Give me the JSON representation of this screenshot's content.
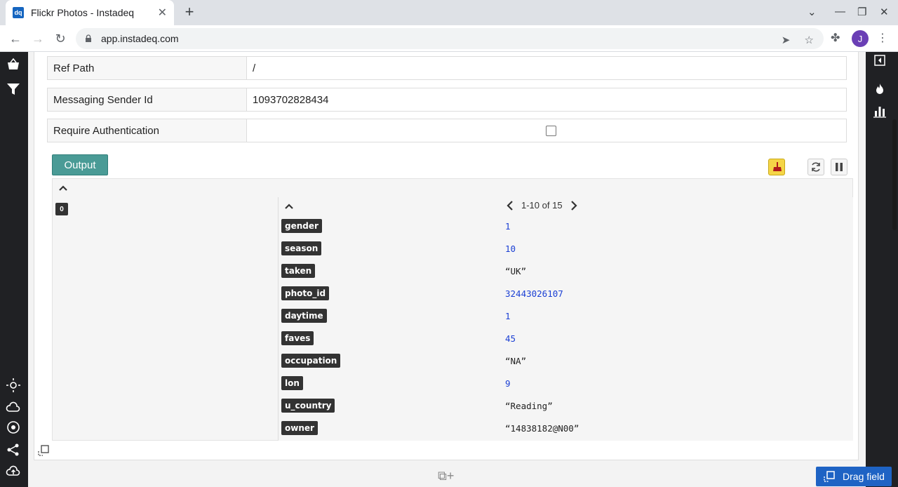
{
  "browser": {
    "tab_title": "Flickr Photos - Instadeq",
    "tab_favicon": "dq",
    "url": "app.instadeq.com",
    "avatar_letter": "J"
  },
  "props": [
    {
      "label": "Ref Path",
      "value": "/"
    },
    {
      "label": "Messaging Sender Id",
      "value": "1093702828434"
    },
    {
      "label": "Require Authentication",
      "value": ""
    }
  ],
  "output": {
    "button_label": "Output",
    "index_badge": "0",
    "pager_text": "1-10 of 15",
    "fields": [
      {
        "key": "gender",
        "value": "1",
        "type": "num"
      },
      {
        "key": "season",
        "value": "10",
        "type": "num"
      },
      {
        "key": "taken",
        "value": "“UK”",
        "type": "str"
      },
      {
        "key": "photo_id",
        "value": "32443026107",
        "type": "num"
      },
      {
        "key": "daytime",
        "value": "1",
        "type": "num"
      },
      {
        "key": "faves",
        "value": "45",
        "type": "num"
      },
      {
        "key": "occupation",
        "value": "“NA”",
        "type": "str"
      },
      {
        "key": "lon",
        "value": "9",
        "type": "num"
      },
      {
        "key": "u_country",
        "value": "“Reading”",
        "type": "str"
      },
      {
        "key": "owner",
        "value": "“14838182@N00”",
        "type": "str"
      }
    ]
  },
  "footer": {
    "drag_field_label": "Drag field"
  },
  "colors": {
    "output_button": "#4a9b96",
    "rail": "#202124",
    "drag_field": "#1e63c4",
    "number_value": "#1a3fd4"
  }
}
